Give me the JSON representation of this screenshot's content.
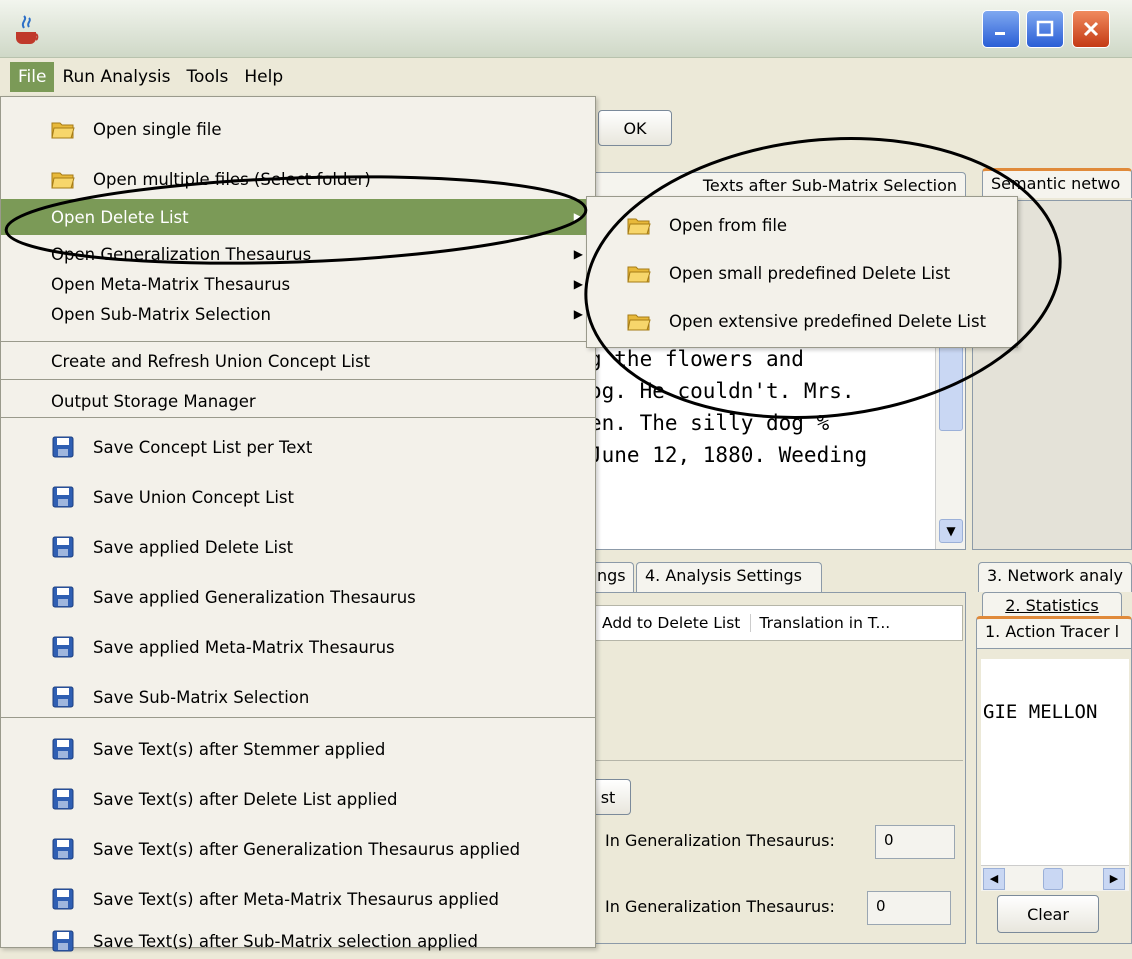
{
  "menubar": {
    "items": [
      "File",
      "Run Analysis",
      "Tools",
      "Help"
    ]
  },
  "background": {
    "ok_button": "OK",
    "tab_texts_after_submatrix": "Texts after Sub-Matrix Selection",
    "tab_semantic_network": "Semantic netwo",
    "text_lines": [
      "g the flowers and",
      "og. He couldn't. Mrs.",
      "en. The silly dog %",
      "June 12, 1880. Weeding"
    ],
    "tab_settings_partial": "ngs",
    "tab_analysis_settings": "4. Analysis Settings",
    "table_header_add_delete": "Add to Delete List",
    "table_header_translation": "Translation in T...",
    "button_partial_list": "st",
    "label_in_generalization_1": "In Generalization Thesaurus:",
    "value_in_generalization_1": "0",
    "label_in_generalization_2": "In Generalization Thesaurus:",
    "value_in_generalization_2": "0",
    "right_tab_network_analysis": "3. Network analy",
    "right_tab_statistics": "2. Statistics",
    "right_tab_action_tracer": "1. Action Tracer l",
    "right_text": "GIE MELLON",
    "clear_button": "Clear"
  },
  "file_menu": {
    "items": [
      {
        "label": "Open single file",
        "icon": "folder-open-icon"
      },
      {
        "label": "Open multiple files (Select folder)",
        "icon": "folder-open-icon"
      },
      {
        "label": "Open Delete List",
        "submenu": true,
        "selected": true
      },
      {
        "label": "Open Generalization Thesaurus",
        "submenu": true
      },
      {
        "label": "Open Meta-Matrix Thesaurus",
        "submenu": true
      },
      {
        "label": "Open Sub-Matrix Selection",
        "submenu": true
      },
      {
        "label": "Create and Refresh Union Concept List"
      },
      {
        "label": "Output Storage Manager"
      },
      {
        "label": "Save Concept List per Text",
        "icon": "save-icon"
      },
      {
        "label": "Save Union Concept List",
        "icon": "save-icon"
      },
      {
        "label": "Save applied Delete List",
        "icon": "save-icon"
      },
      {
        "label": "Save applied Generalization Thesaurus",
        "icon": "save-icon"
      },
      {
        "label": "Save applied Meta-Matrix Thesaurus",
        "icon": "save-icon"
      },
      {
        "label": "Save Sub-Matrix Selection",
        "icon": "save-icon"
      },
      {
        "label": "Save Text(s) after Stemmer applied",
        "icon": "save-icon"
      },
      {
        "label": "Save Text(s) after Delete List applied",
        "icon": "save-icon"
      },
      {
        "label": "Save Text(s) after Generalization Thesaurus applied",
        "icon": "save-icon"
      },
      {
        "label": "Save Text(s) after Meta-Matrix Thesaurus applied",
        "icon": "save-icon"
      },
      {
        "label": "Save Text(s) after Sub-Matrix selection applied",
        "icon": "save-icon"
      }
    ]
  },
  "submenu": {
    "items": [
      {
        "label": "Open from file",
        "icon": "folder-open-icon"
      },
      {
        "label": "Open small predefined Delete List",
        "icon": "folder-open-icon"
      },
      {
        "label": "Open extensive predefined Delete List",
        "icon": "folder-open-icon"
      }
    ]
  },
  "colors": {
    "menu_highlight": "#7b9a57",
    "window_bg": "#ece9d8"
  }
}
